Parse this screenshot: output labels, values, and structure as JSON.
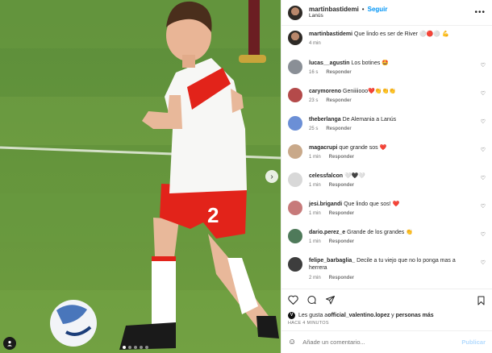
{
  "header": {
    "username": "martinbastidemi",
    "separator": "•",
    "follow_label": "Seguir",
    "location": "Lanús",
    "more_icon": "more-horizontal-icon"
  },
  "caption": {
    "username": "martinbastidemi",
    "text": "Que lindo es ser de River ⚪🔴⚪ 💪",
    "time": "4 min"
  },
  "comments": [
    {
      "username": "lucas__agustin",
      "text": "Los botines 🤩",
      "time": "16 s",
      "reply": "Responder",
      "avatar_color": "#8a8f96"
    },
    {
      "username": "carymoreno",
      "text": "Geniiiiooo❤️👏👏👏",
      "time": "23 s",
      "reply": "Responder",
      "avatar_color": "#b44a4a"
    },
    {
      "username": "theberlanga",
      "text": "De Alemania a Lanús",
      "time": "25 s",
      "reply": "Responder",
      "avatar_color": "#6b8fd6"
    },
    {
      "username": "magacrupi",
      "text": "que grande sos ❤️",
      "time": "1 min",
      "reply": "Responder",
      "avatar_color": "#c9a98a"
    },
    {
      "username": "celessfalcon",
      "text": "🤍🖤🤍",
      "time": "1 min",
      "reply": "Responder",
      "avatar_color": "#d8d8d8"
    },
    {
      "username": "jesi.brigandi",
      "text": "Que lindo que sos! ❤️",
      "time": "1 min",
      "reply": "Responder",
      "avatar_color": "#c77a7a"
    },
    {
      "username": "dario.perez_e",
      "text": "Grande de los grandes 👏",
      "time": "1 min",
      "reply": "Responder",
      "avatar_color": "#4f7a5a"
    },
    {
      "username": "felipe_barbaglia_",
      "text": "Decile a tu viejo que no lo ponga mas a herrera",
      "time": "2 min",
      "reply": "Responder",
      "avatar_color": "#3d3d3d"
    }
  ],
  "likes": {
    "prefix": "Les gusta a ",
    "user": "official_valentino.lopez",
    "suffix": " y ",
    "others": "personas más"
  },
  "timestamp": "HACE 4 MINUTOS",
  "add_comment": {
    "placeholder": "Añade un comentario...",
    "publish_label": "Publicar"
  },
  "media": {
    "jersey_number": "2",
    "carousel_count": 5,
    "carousel_active": 0
  },
  "colors": {
    "link": "#0095f6",
    "publish_disabled": "#b3dbff",
    "river_red": "#e2231a"
  }
}
